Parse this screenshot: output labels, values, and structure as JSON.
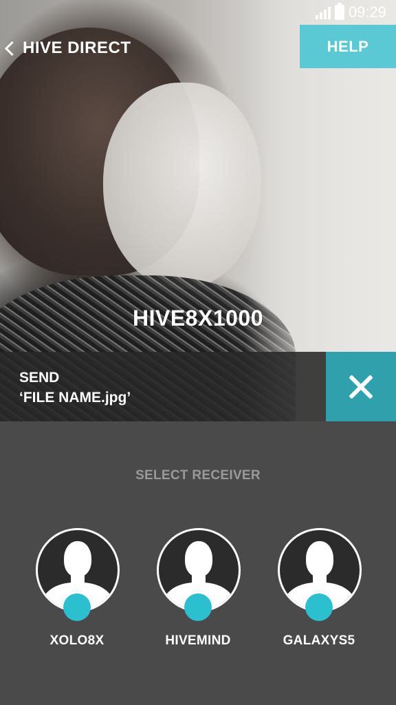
{
  "status_bar": {
    "time": "09:29",
    "signal_icon": "signal-icon",
    "battery_icon": "battery-icon"
  },
  "header": {
    "back_label": "HIVE DIRECT",
    "help_label": "HELP"
  },
  "hero": {
    "device_title": "HIVE8X1000"
  },
  "send_bar": {
    "line1": "SEND",
    "line2": "‘FILE NAME.jpg’",
    "close_icon": "close-icon"
  },
  "receivers": {
    "label": "SELECT RECEIVER",
    "items": [
      {
        "name": "XOLO8X"
      },
      {
        "name": "HIVEMIND"
      },
      {
        "name": "GALAXYS5"
      }
    ]
  },
  "colors": {
    "accent": "#5ac9d4",
    "close_bg": "#2fa0ac",
    "panel_bg": "#4a4a4a",
    "dot": "#2bbfcf"
  }
}
